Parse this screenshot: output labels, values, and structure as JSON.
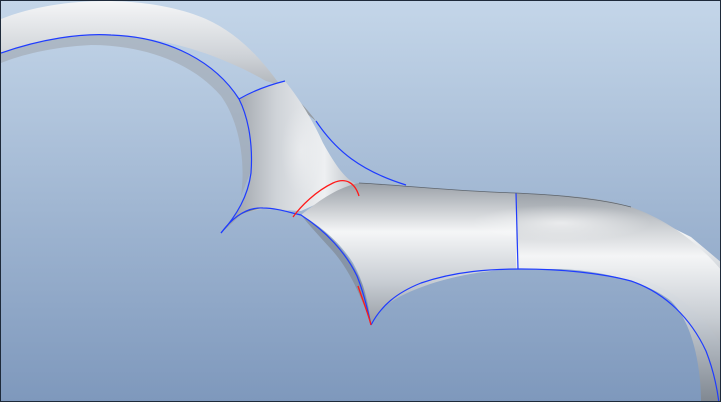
{
  "viewport": {
    "background_top": "#c4d6e9",
    "background_bottom": "#7e98bc"
  },
  "model": {
    "surface_light": "#f5f6f7",
    "surface_mid": "#cfd3d8",
    "surface_dark": "#8f959c",
    "surface_edge": "#6f767e",
    "edge_blue": "#1f3cff",
    "edge_red": "#ff1a1a"
  },
  "icons": {
    "surface": "swept-surface-icon"
  }
}
